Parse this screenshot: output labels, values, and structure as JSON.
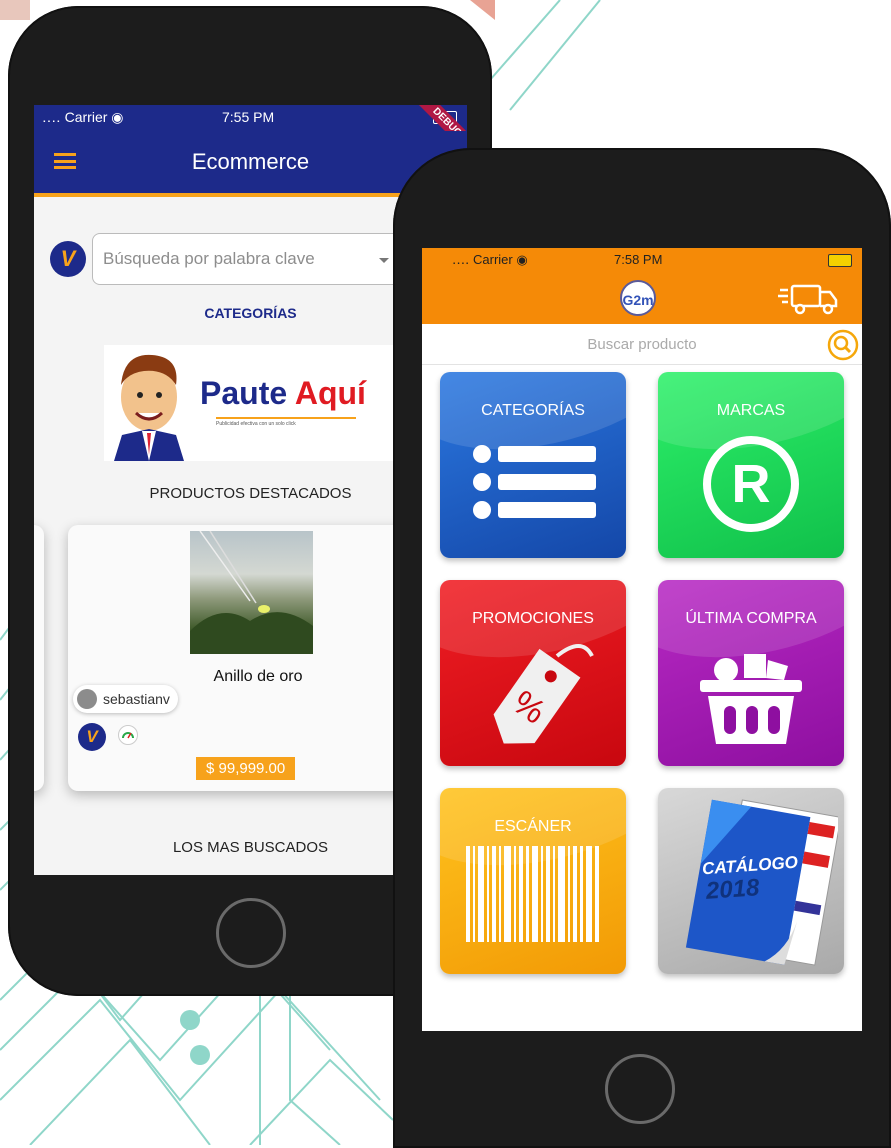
{
  "phone_left": {
    "status_bar": {
      "carrier": "․․․․ Carrier ◉",
      "time": "7:55 PM",
      "debug_label": "DEBUG"
    },
    "app_bar": {
      "title": "Ecommerce"
    },
    "search": {
      "placeholder": "Búsqueda por palabra clave"
    },
    "logo_letter": "V",
    "sections": {
      "categories": "CATEGORÍAS",
      "featured": "PRODUCTOS DESTACADOS",
      "most_searched": "LOS MAS BUSCADOS"
    },
    "banner": {
      "text_1": "Paute",
      "text_2": "Aquí",
      "tagline": "Publicidad efectiva con un solo click"
    },
    "product": {
      "name": "Anillo de oro",
      "seller": "sebastianv",
      "price": "$ 99,999.00"
    }
  },
  "phone_right": {
    "status_bar": {
      "carrier": "․․․․ Carrier ◉",
      "time": "7:58 PM"
    },
    "logo": "G2m",
    "search": {
      "placeholder": "Buscar producto"
    },
    "tiles": [
      {
        "label": "CATEGORÍAS",
        "icon": "list-icon",
        "color": "#1f5fc4"
      },
      {
        "label": "MARCAS",
        "icon": "registered-icon",
        "color": "#1fd25a"
      },
      {
        "label": "PROMOCIONES",
        "icon": "discount-tag-icon",
        "color": "#e0111a"
      },
      {
        "label": "ÚLTIMA COMPRA",
        "icon": "shopping-basket-icon",
        "color": "#a81cb4"
      },
      {
        "label": "ESCÁNER",
        "icon": "barcode-icon",
        "color": "#f5a70b"
      },
      {
        "label": "",
        "icon": "catalog-icon",
        "color": "#bdbdbd"
      }
    ],
    "catalog": {
      "title": "CATÁLOGO",
      "year": "2018"
    }
  },
  "colors": {
    "navy": "#1d2a8a",
    "orange": "#f58a07",
    "accent": "#f7a21b",
    "background_lines": "#7fcfc2"
  }
}
